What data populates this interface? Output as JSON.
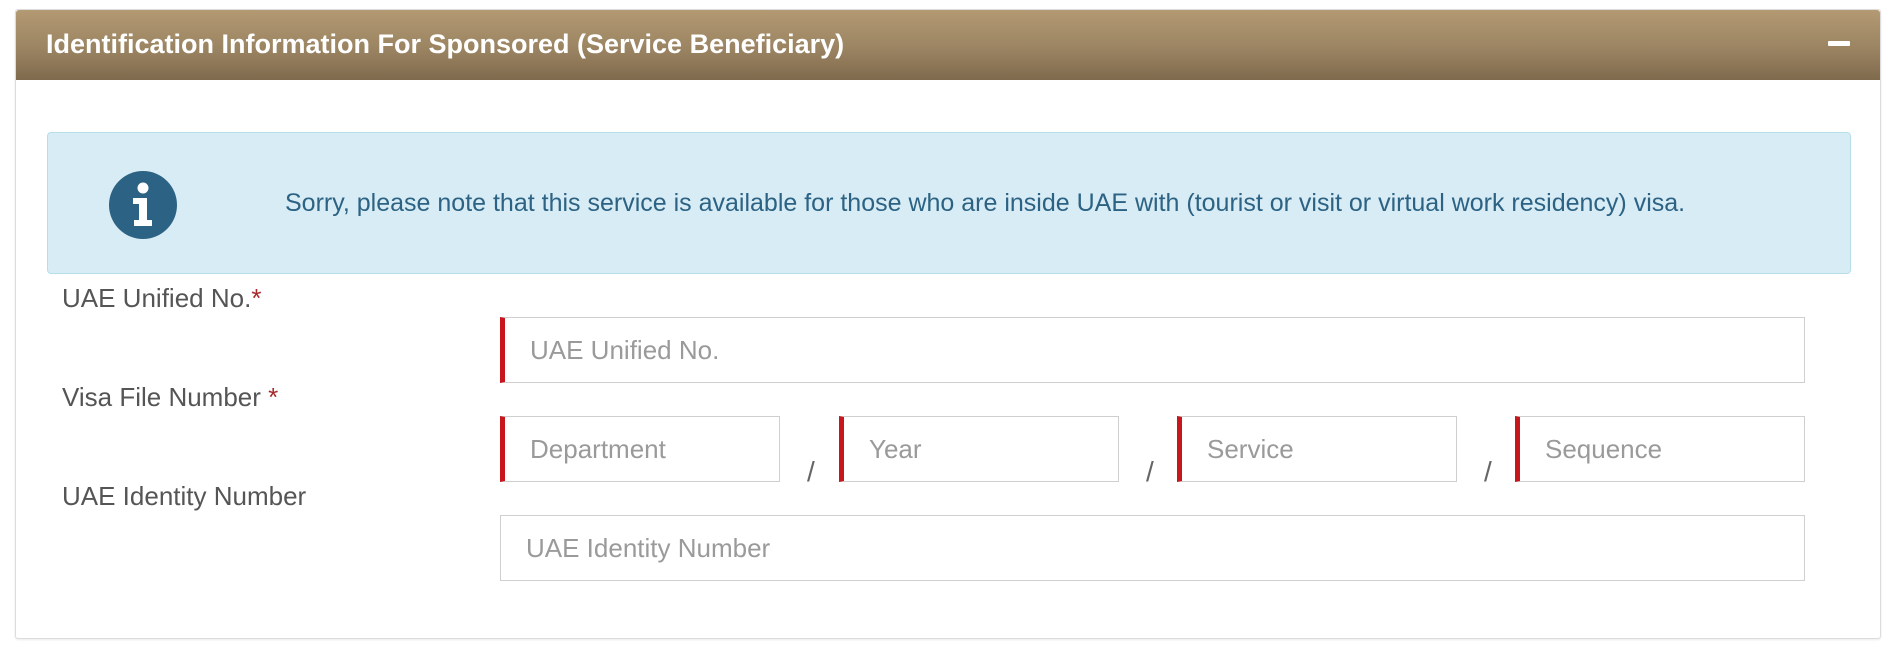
{
  "panel": {
    "title": "Identification Information For Sponsored (Service Beneficiary)",
    "collapse_icon": "minus-icon"
  },
  "alert": {
    "icon": "info-circle-icon",
    "icon_color": "#2c6283",
    "message": "Sorry, please note that this service is available for those who are inside UAE with (tourist or visit or virtual work residency) visa."
  },
  "form": {
    "unified_no": {
      "label": "UAE Unified No.",
      "required_mark": "*",
      "placeholder": "UAE Unified No.",
      "value": ""
    },
    "visa_file_number": {
      "label": "Visa File Number ",
      "required_mark": "*",
      "separator": "/",
      "fields": [
        {
          "placeholder": "Department",
          "value": ""
        },
        {
          "placeholder": "Year",
          "value": ""
        },
        {
          "placeholder": "Service",
          "value": ""
        },
        {
          "placeholder": "Sequence",
          "value": ""
        }
      ]
    },
    "identity_number": {
      "label": "UAE Identity Number",
      "placeholder": "UAE Identity Number",
      "value": ""
    }
  },
  "colors": {
    "header_gradient_top": "#b39a73",
    "header_gradient_bottom": "#7f6a4d",
    "required_accent": "#c8161d",
    "alert_bg": "#d8ecf5"
  }
}
